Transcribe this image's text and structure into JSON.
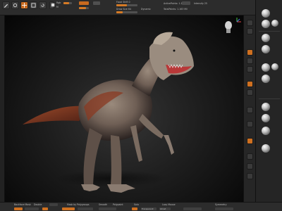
{
  "topbar": {
    "label_1": "Focal Shift 0",
    "label_2": "Draw Size 64",
    "label_3": "Dynamic",
    "label_4": "ActivePoints: 1.163 Mil",
    "label_5": "TotalPoints: 1.163 Mil",
    "label_6": "Intensity 25",
    "label_7": "Rgb",
    "label_8": "M"
  },
  "bottombar": {
    "label_1": "Backface Mask",
    "label_2": "Double",
    "label_3": "Mask by Polygroups",
    "label_4": "Smooth",
    "label_5": "Polypaint",
    "label_6": "Solo",
    "label_7": "Transparent",
    "label_8": "Ghost",
    "label_9": "Lazy Mouse",
    "label_10": "Symmetry"
  },
  "colors": {
    "accent": "#cf7020",
    "panel": "#2c2c2c",
    "skin": "#8a7d71",
    "skin_red": "#8a3a22"
  }
}
